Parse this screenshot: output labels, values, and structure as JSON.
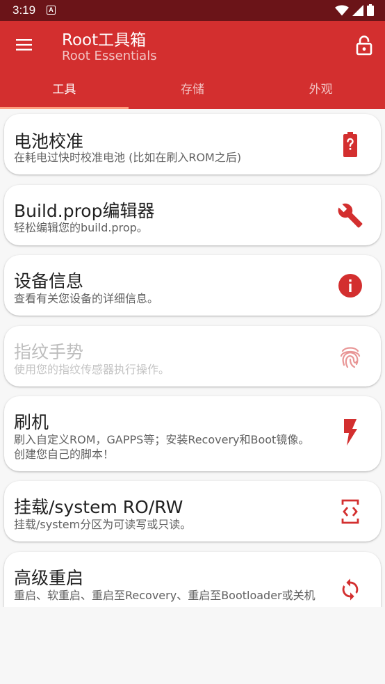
{
  "status_bar": {
    "time": "3:19",
    "notification_glyph": "A",
    "icons": [
      "wifi-icon",
      "signal-icon",
      "battery-icon"
    ]
  },
  "app_bar": {
    "title": "Root工具箱",
    "subtitle": "Root Essentials",
    "menu_icon": "hamburger-menu-icon",
    "action_icon": "lock-open-icon"
  },
  "tabs": [
    {
      "label": "工具",
      "active": true
    },
    {
      "label": "存储",
      "active": false
    },
    {
      "label": "外观",
      "active": false
    }
  ],
  "items": [
    {
      "title": "电池校准",
      "desc": "在耗电过快时校准电池 (比如在刷入ROM之后)",
      "icon": "battery-question-icon",
      "enabled": true
    },
    {
      "title": "Build.prop编辑器",
      "desc": "轻松编辑您的build.prop。",
      "icon": "wrench-icon",
      "enabled": true
    },
    {
      "title": "设备信息",
      "desc": "查看有关您设备的详细信息。",
      "icon": "info-icon",
      "enabled": true
    },
    {
      "title": "指纹手势",
      "desc": "使用您的指纹传感器执行操作。",
      "icon": "fingerprint-icon",
      "enabled": false
    },
    {
      "title": "刷机",
      "desc": "刷入自定义ROM，GAPPS等；安装Recovery和Boot镜像。创建您自己的脚本！",
      "icon": "flash-icon",
      "enabled": true
    },
    {
      "title": "挂载/system RO/RW",
      "desc": "挂载/system分区为可读写或只读。",
      "icon": "code-mount-icon",
      "enabled": true
    },
    {
      "title": "高级重启",
      "desc": "重启、软重启、重启至Recovery、重启至Bootloader或关机",
      "icon": "sync-icon",
      "enabled": true
    }
  ],
  "colors": {
    "primary": "#d32f2f",
    "status_bar": "#6b1418",
    "accent": "#ff9e80",
    "icon": "#d32f2f"
  }
}
